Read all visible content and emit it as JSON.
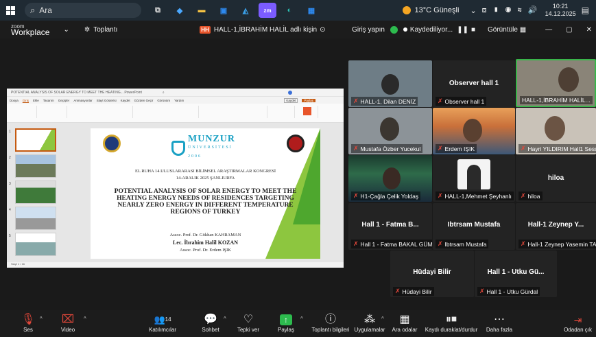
{
  "taskbar": {
    "search_placeholder": "Ara",
    "weather": "13°C Güneşli",
    "time": "10:21",
    "date": "14.12.2025"
  },
  "zoom_header": {
    "app_top": "zoom",
    "app_name": "Workplace",
    "meeting_label": "Toplantı",
    "share_badge": "HH",
    "sharing_text": "HALL-1,İBRAHİM HALİL adlı kişin",
    "signin": "Giriş yapın",
    "recording": "Kaydediliyor...",
    "view": "Görüntüle"
  },
  "presentation": {
    "window_title": "POTENTIAL ANALYSIS OF SOLAR ENERGY TO MEET THE HEATING...  PowerPoint",
    "menu": [
      "Dosya",
      "Giriş",
      "Ekle",
      "Tasarım",
      "Geçişler",
      "Animasyonlar",
      "Slayt Gösterisi",
      "Kaydet",
      "Gözden Geçir",
      "Görünüm",
      "Yardım"
    ],
    "share_button": "Paylaş",
    "record_button": "Kaydet",
    "university": "MUNZUR",
    "university_sub": "ÜNİVERSİTESİ",
    "university_year": "2006",
    "conference_line1": "EL RUHA 14.ULUSLARARASI BİLİMSEL ARAŞTIRMALAR KONGRESİ",
    "conference_line2": "14-ARALIK 2025 ŞANLIURFA",
    "title": "POTENTIAL ANALYSIS OF SOLAR ENERGY TO MEET THE HEATING ENERGY NEEDS OF RESIDENCES TARGETING NEARLY ZERO ENERGY IN DIFFERENT TEMPERATURE REGIONS OF TURKEY",
    "author1": "Assoc. Prof. Dr. Gökhan KAHRAMAN",
    "author2": "Lec. İbrahim Halil KOZAN",
    "author3": "Assoc. Prof. Dr. Erdem IŞIK",
    "status_left": "Slayt 1 / 16",
    "thumb_numbers": [
      "1",
      "2",
      "3",
      "4",
      "5"
    ]
  },
  "participants": [
    {
      "id": "dilan",
      "name": "HALL-1, Dilan DENİZ",
      "muted": true
    },
    {
      "id": "observer",
      "name": "Observer hall 1",
      "center": "Observer hall 1",
      "muted": true
    },
    {
      "id": "ibrahim",
      "name": "HALL-1,İBRAHİM HALİL...",
      "muted": false
    },
    {
      "id": "mustafa",
      "name": "Mustafa Özber Yucekul",
      "muted": true
    },
    {
      "id": "erdem",
      "name": "Erdem IŞIK",
      "muted": true
    },
    {
      "id": "hayri",
      "name": "Hayri YILDIRIM Hall1 Sessi...",
      "muted": true
    },
    {
      "id": "cagla",
      "name": "H1-Çağla Çelik Yoldaş",
      "muted": true
    },
    {
      "id": "mehmet",
      "name": "HALL-1,Mehmet Şeyhanlı",
      "muted": true
    },
    {
      "id": "hiloa",
      "name": "hiloa",
      "center": "hiloa",
      "muted": true
    },
    {
      "id": "fatma",
      "name": "Hall 1 - Fatma BAKAL GÜM...",
      "center": "Hall 1 - Fatma B...",
      "muted": true
    },
    {
      "id": "ibtrsam",
      "name": "Ibtrsam Mustafa",
      "center": "Ibtrsam Mustafa",
      "muted": true
    },
    {
      "id": "zeynep",
      "name": "Hall-1 Zeynep Yasemin TAŞ",
      "center": "Hall-1 Zeynep Y...",
      "muted": true
    },
    {
      "id": "hudayi",
      "name": "Hüdayi Bilir",
      "center": "Hüdayi Bilir",
      "muted": true
    },
    {
      "id": "utku",
      "name": "Hall 1 - Utku Gürdal",
      "center": "Hall 1 - Utku Gü...",
      "muted": true
    }
  ],
  "toolbar": {
    "audio": "Ses",
    "video": "Video",
    "participants_count": "14",
    "participants": "Katılımcılar",
    "chat": "Sohbet",
    "react": "Tepki ver",
    "share": "Paylaş",
    "meeting_info": "Toplantı bilgileri",
    "apps": "Uygulamalar",
    "rooms": "Ara odalar",
    "pause": "Kaydı duraklat/durdur",
    "more": "Daha fazla",
    "leave": "Odadan çık"
  }
}
